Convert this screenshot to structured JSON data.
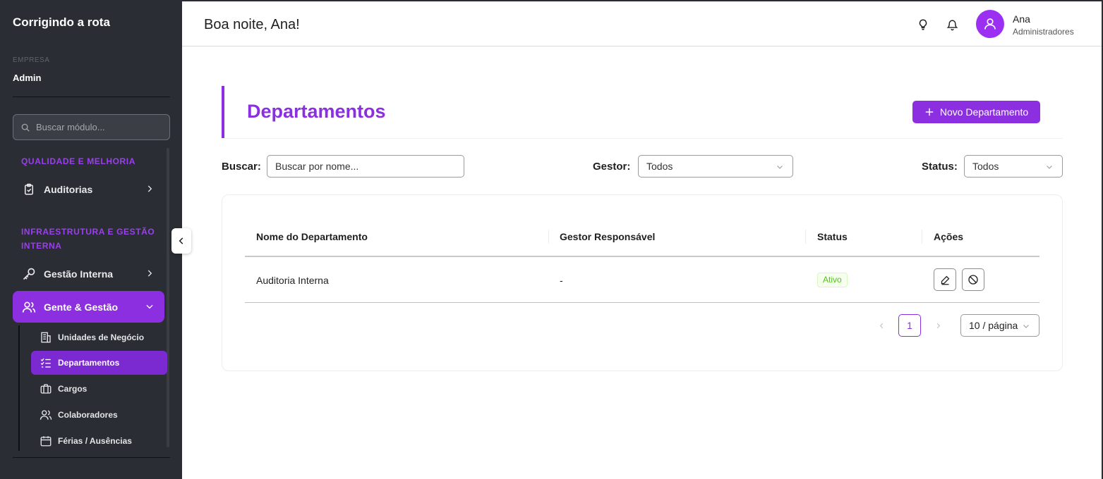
{
  "sidebar": {
    "brand": "Corrigindo a rota",
    "company_label": "EMPRESA",
    "company_name": "Admin",
    "search_placeholder": "Buscar módulo...",
    "sections": [
      {
        "title": "QUALIDADE E MELHORIA",
        "items": [
          {
            "label": "Auditorias",
            "icon": "clipboard-check-icon"
          }
        ]
      },
      {
        "title": "INFRAESTRUTURA E GESTÃO INTERNA",
        "items": [
          {
            "label": "Gestão Interna",
            "icon": "key-icon"
          },
          {
            "label": "Gente & Gestão",
            "icon": "users-icon",
            "expanded": true
          }
        ]
      }
    ],
    "subitems": [
      {
        "label": "Unidades de Negócio",
        "icon": "building-icon"
      },
      {
        "label": "Departamentos",
        "icon": "checklist-icon",
        "active": true
      },
      {
        "label": "Cargos",
        "icon": "briefcase-icon"
      },
      {
        "label": "Colaboradores",
        "icon": "users-icon"
      },
      {
        "label": "Férias / Ausências",
        "icon": "calendar-icon"
      }
    ]
  },
  "header": {
    "greeting": "Boa noite, Ana!",
    "icons": [
      "lightbulb-icon",
      "bell-icon"
    ],
    "user": {
      "name": "Ana",
      "role": "Administradores",
      "avatar_icon": "user-icon"
    }
  },
  "main": {
    "title": "Departamentos",
    "new_button": "Novo Departamento",
    "filters": {
      "search_label": "Buscar:",
      "search_placeholder": "Buscar por nome...",
      "manager_label": "Gestor:",
      "manager_value": "Todos",
      "status_label": "Status:",
      "status_value": "Todos"
    },
    "table": {
      "columns": [
        "Nome do Departamento",
        "Gestor Responsável",
        "Status",
        "Ações"
      ],
      "rows": [
        {
          "name": "Auditoria Interna",
          "manager": "-",
          "status": "Ativo",
          "actions": [
            "edit-icon",
            "block-icon"
          ]
        }
      ]
    },
    "pagination": {
      "current_page": "1",
      "page_size": "10 / página"
    }
  },
  "colors": {
    "sidebar_bg": "#2a2d33",
    "accent": "#8b2fe0",
    "status_active": "#52c41a"
  }
}
